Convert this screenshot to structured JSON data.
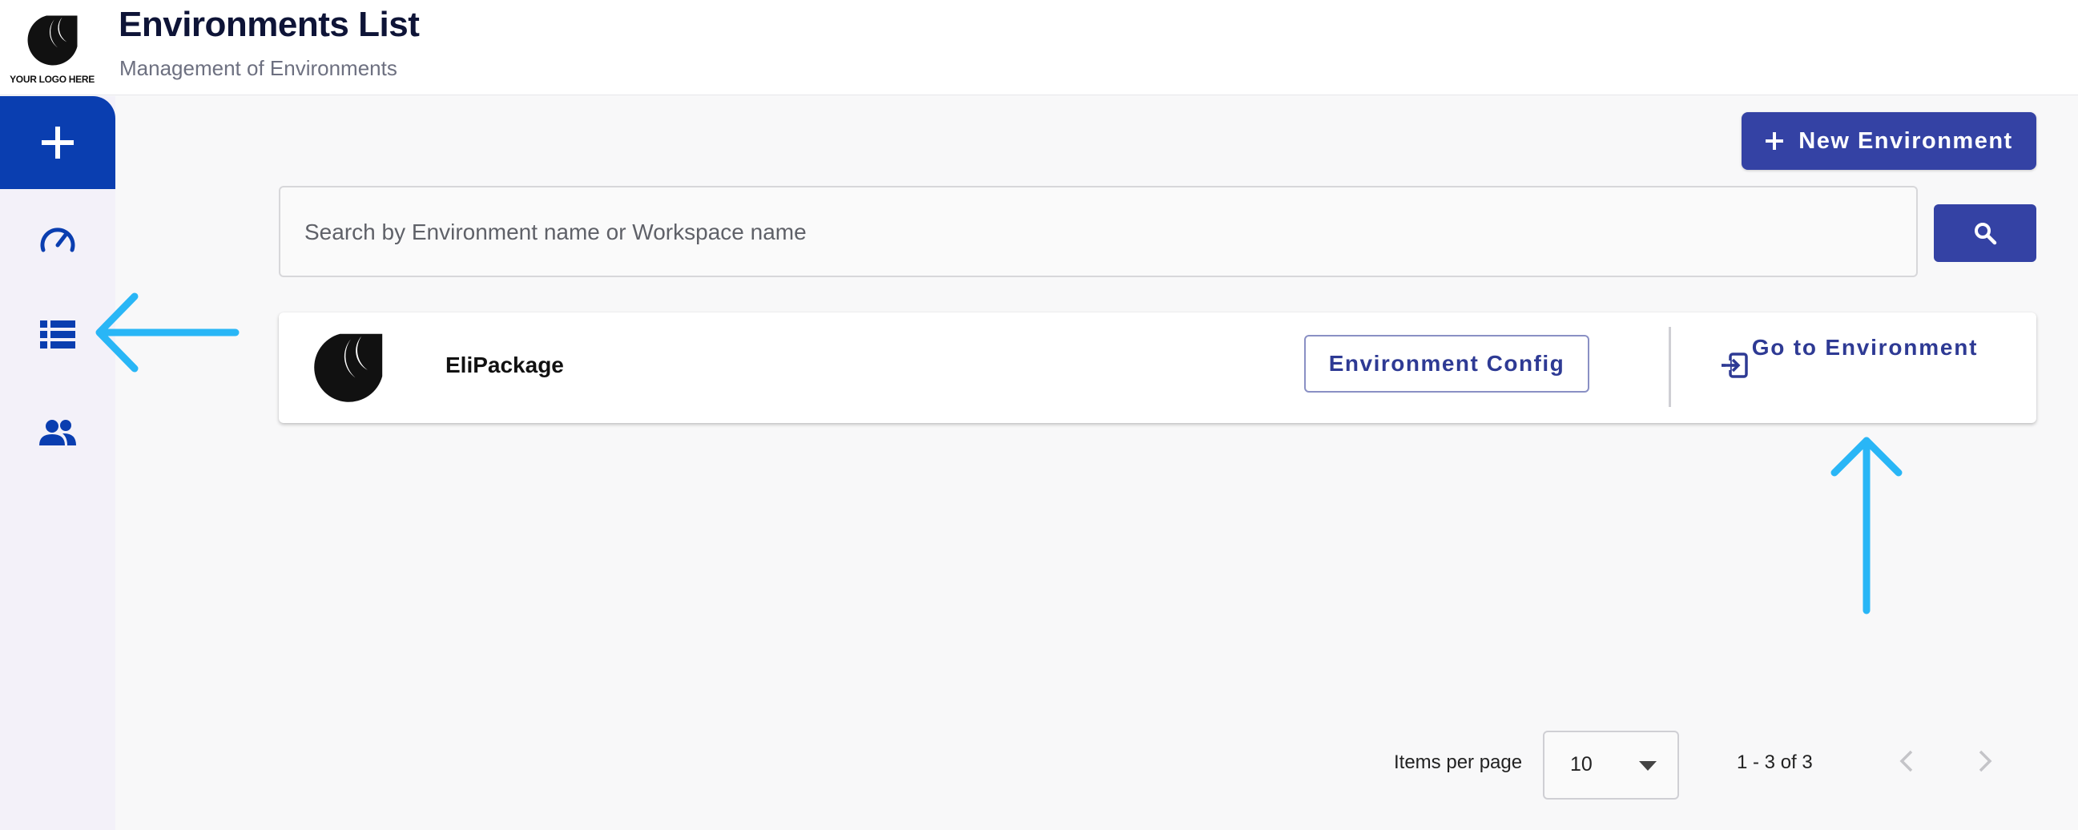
{
  "header": {
    "logo_text": "YOUR LOGO HERE",
    "title": "Environments List",
    "subtitle": "Management of Environments"
  },
  "sidebar": {
    "items": [
      {
        "name": "add",
        "icon": "plus-icon"
      },
      {
        "name": "dashboard",
        "icon": "speedometer-icon"
      },
      {
        "name": "environments-list",
        "icon": "list-icon",
        "active": true
      },
      {
        "name": "users",
        "icon": "people-icon"
      }
    ]
  },
  "toolbar": {
    "new_environment_label": "New Environment",
    "search_placeholder": "Search by Environment name or Workspace name"
  },
  "environments": [
    {
      "name": "EliPackage",
      "config_label": "Environment Config",
      "goto_label": "Go to Environment"
    }
  ],
  "pagination": {
    "items_per_page_label": "Items per page",
    "items_per_page_value": "10",
    "range_label": "1 - 3 of 3"
  },
  "colors": {
    "primary": "#3442a4",
    "sidebar_accent": "#0a3eb0",
    "annotation_arrow": "#29b6f6"
  }
}
